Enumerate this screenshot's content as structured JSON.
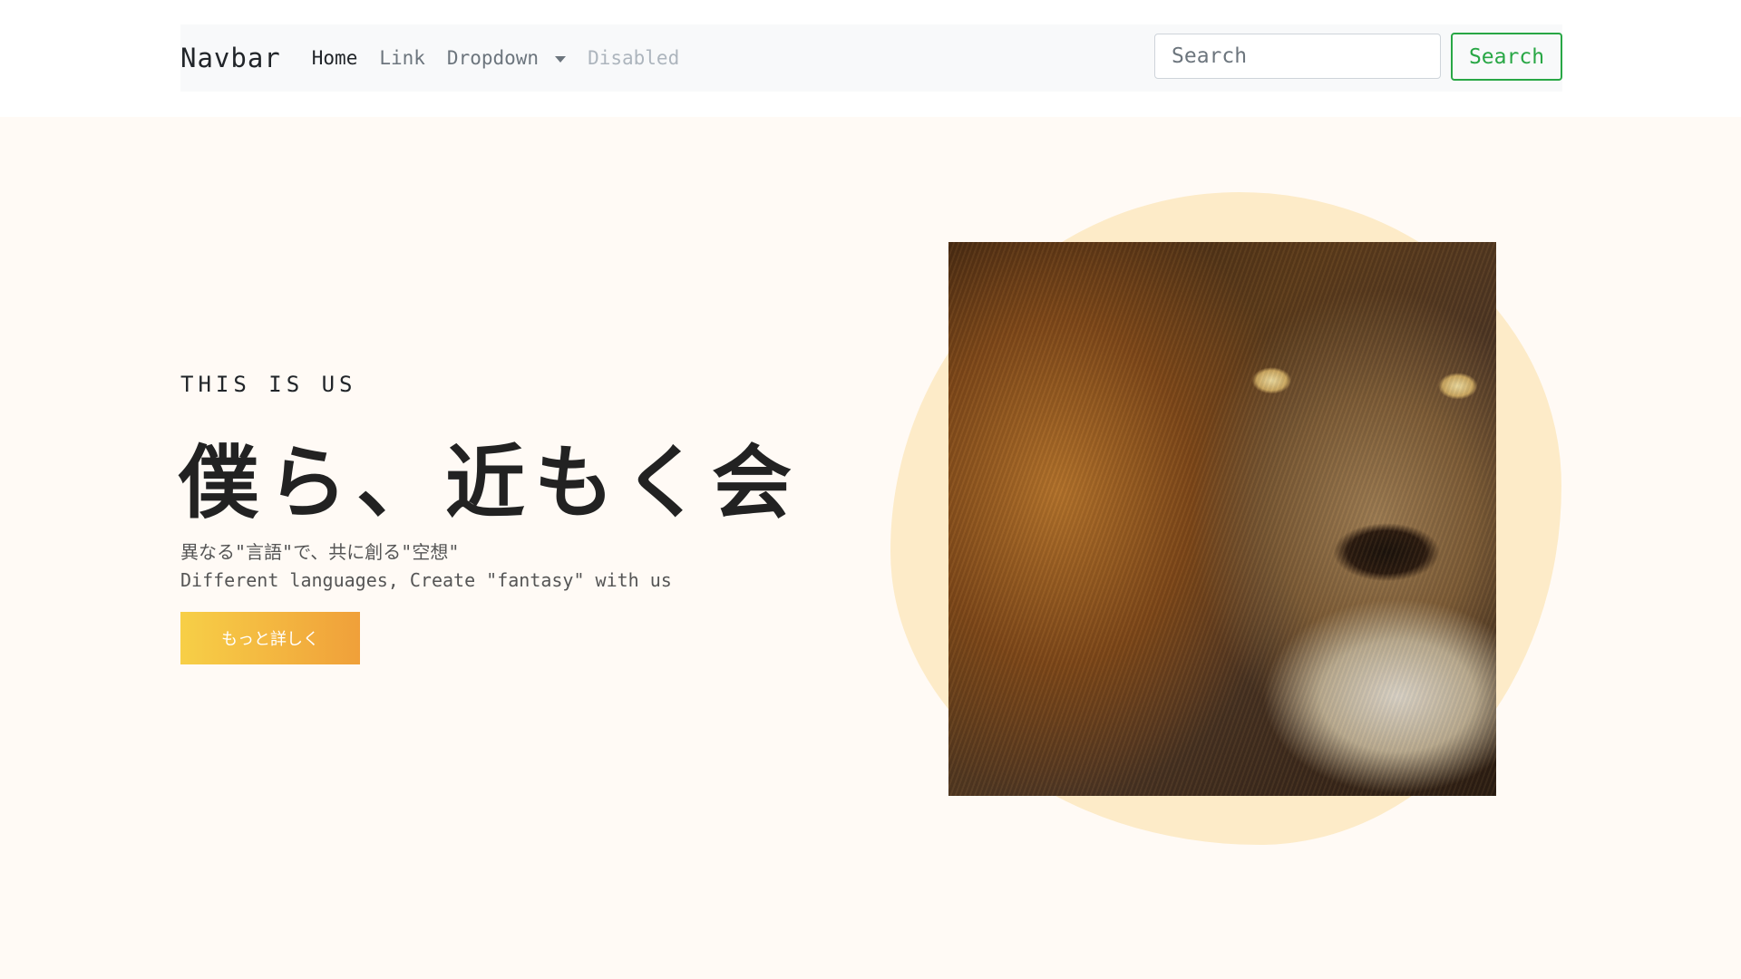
{
  "navbar": {
    "brand": "Navbar",
    "links": [
      {
        "label": "Home",
        "state": "active"
      },
      {
        "label": "Link",
        "state": "normal"
      },
      {
        "label": "Dropdown",
        "state": "dropdown"
      },
      {
        "label": "Disabled",
        "state": "disabled"
      }
    ],
    "search_placeholder": "Search",
    "search_button": "Search"
  },
  "hero": {
    "eyebrow": "THIS IS US",
    "headline": "僕ら、近もく会",
    "subtitle_jp": "異なる\"言語\"で、共に創る\"空想\"",
    "subtitle_en": "Different languages, Create \"fantasy\" with us",
    "cta_label": "もっと詳しく",
    "image_subject": "lion-face-photo"
  },
  "colors": {
    "page_background": "#fffaf5",
    "navbar_background": "#f8f9fa",
    "search_button": "#28a745",
    "cta_gradient_start": "#f7cf47",
    "cta_gradient_end": "#f0a03a",
    "blob": "#fdebc8"
  }
}
